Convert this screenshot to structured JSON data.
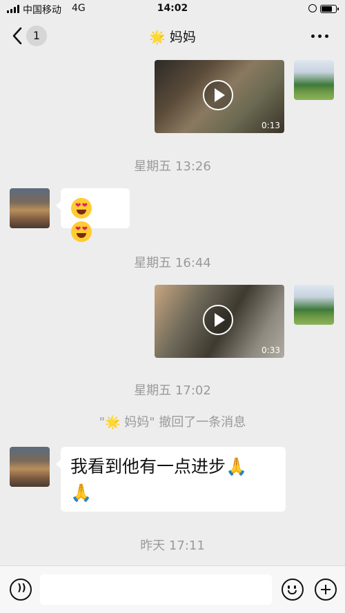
{
  "status_bar": {
    "carrier": "中国移动",
    "network": "4G",
    "time": "14:02"
  },
  "nav": {
    "unread_count": "1",
    "title": "🌟 妈妈",
    "more_icon": "more-dots-icon",
    "back_icon": "chevron-left-icon"
  },
  "messages": [
    {
      "type": "video",
      "sender": "self",
      "duration": "0:13"
    },
    {
      "type": "timestamp",
      "text": "星期五 13:26"
    },
    {
      "type": "emoji",
      "sender": "peer",
      "emoji": "😍😍"
    },
    {
      "type": "timestamp",
      "text": "星期五 16:44"
    },
    {
      "type": "video",
      "sender": "self",
      "duration": "0:33"
    },
    {
      "type": "timestamp",
      "text": "星期五 17:02"
    },
    {
      "type": "recall",
      "text": "\"🌟 妈妈\" 撤回了一条消息"
    },
    {
      "type": "text",
      "sender": "peer",
      "text_line1": "我看到他有一点进步🙏",
      "text_line2": "🙏"
    },
    {
      "type": "timestamp",
      "text": "昨天 17:11"
    }
  ],
  "input_bar": {
    "voice_icon": "voice-icon",
    "emoji_icon": "smiley-icon",
    "plus_icon": "plus-icon",
    "placeholder": ""
  }
}
